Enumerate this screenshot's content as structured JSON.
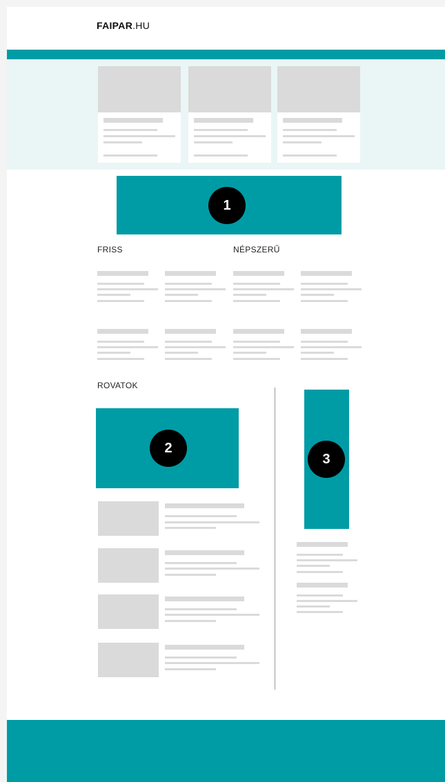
{
  "header": {
    "brand_bold": "FAIPAR",
    "brand_rest": ".HU"
  },
  "sections": {
    "friss": "FRISS",
    "nepszeru": "NÉPSZERŰ",
    "rovatok": "ROVATOK"
  },
  "ads": [
    {
      "number": "1"
    },
    {
      "number": "2"
    },
    {
      "number": "3"
    }
  ],
  "colors": {
    "accent": "#009ca6",
    "hero_bg": "#eaf6f6",
    "placeholder": "#dadada"
  }
}
